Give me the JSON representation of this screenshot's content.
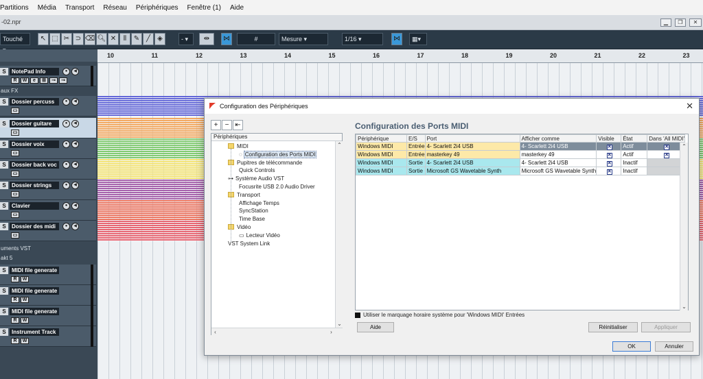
{
  "menubar": [
    "Partitions",
    "Média",
    "Transport",
    "Réseau",
    "Périphériques",
    "Fenêtre (1)",
    "Aide"
  ],
  "window": {
    "file_suffix": "-02.npr"
  },
  "toolbar": {
    "mode": "Touché",
    "quant_label": "Mesure",
    "quant_value": "1/16",
    "grid_symbol": "#"
  },
  "ruler": [
    "10",
    "11",
    "12",
    "13",
    "14",
    "15",
    "16",
    "17",
    "18",
    "19",
    "20",
    "21",
    "22",
    "23"
  ],
  "tracks": [
    {
      "name": "NotePad Info",
      "selected": false
    },
    {
      "name": "Dossier percuss",
      "selected": false,
      "color": "#5b5fd6"
    },
    {
      "name": "Dossier guitare",
      "selected": true,
      "color": "#f3a457"
    },
    {
      "name": "Dossier voix",
      "selected": false,
      "color": "#7cc96a"
    },
    {
      "name": "Dossier back voc",
      "selected": false,
      "color": "#f4e36a"
    },
    {
      "name": "Dossier strings",
      "selected": false,
      "color": "#a25aa8"
    },
    {
      "name": "Clavier",
      "selected": false,
      "color": "#ec6b55"
    },
    {
      "name": "Dossier des midi",
      "selected": false,
      "color": "#e85e6b"
    },
    {
      "name": "MIDI file generate"
    },
    {
      "name": "MIDI file generate"
    },
    {
      "name": "MIDI file generate"
    },
    {
      "name": "Instrument Track"
    }
  ],
  "folder_labels": {
    "fx": "aux FX",
    "vst": "uments VST",
    "kit": "akt 5"
  },
  "dialog": {
    "title": "Configuration des Périphériques",
    "close": "✕",
    "tree_header": "Périphériques",
    "tree": [
      {
        "label": "MIDI",
        "type": "folder",
        "indent": 0
      },
      {
        "label": "Configuration des Ports MIDI",
        "type": "leaf",
        "indent": 1,
        "selected": true
      },
      {
        "label": "Pupitres de télécommande",
        "type": "folder",
        "indent": 0
      },
      {
        "label": "Quick Controls",
        "type": "leaf",
        "indent": 1
      },
      {
        "label": "Système Audio VST",
        "type": "audio",
        "indent": 0
      },
      {
        "label": "Focusrite USB 2.0 Audio Driver",
        "type": "leaf",
        "indent": 1
      },
      {
        "label": "Transport",
        "type": "folder",
        "indent": 0
      },
      {
        "label": "Affichage Temps",
        "type": "leaf",
        "indent": 1
      },
      {
        "label": "SyncStation",
        "type": "leaf",
        "indent": 1
      },
      {
        "label": "Time Base",
        "type": "leaf",
        "indent": 1
      },
      {
        "label": "Vidéo",
        "type": "folder",
        "indent": 0
      },
      {
        "label": "Lecteur Vidéo",
        "type": "video",
        "indent": 1
      },
      {
        "label": "VST System Link",
        "type": "plain",
        "indent": 0
      }
    ],
    "ports_title": "Configuration des Ports MIDI",
    "columns": [
      "Périphérique",
      "E/S",
      "Port",
      "Afficher comme",
      "Visible",
      "État",
      "Dans 'All MIDI'"
    ],
    "rows": [
      {
        "device": "Windows MIDI",
        "io": "Entrée",
        "port": "4- Scarlett 2i4 USB",
        "display": "4- Scarlett 2i4 USB",
        "visible": true,
        "state": "Actif",
        "all_midi": true,
        "row_color": "#fde9a8",
        "sel": true
      },
      {
        "device": "Windows MIDI",
        "io": "Entrée",
        "port": "masterkey 49",
        "display": "masterkey 49",
        "visible": true,
        "state": "Actif",
        "all_midi": true,
        "row_color": "#fde9a8",
        "sel": false
      },
      {
        "device": "Windows MIDI",
        "io": "Sortie",
        "port": "4- Scarlett 2i4 USB",
        "display": "4- Scarlett 2i4 USB",
        "visible": true,
        "state": "Inactif",
        "all_midi": false,
        "row_color": "#a9e8ee",
        "sel": false
      },
      {
        "device": "Windows MIDI",
        "io": "Sortie",
        "port": "Microsoft GS Wavetable Synth",
        "display": "Microsoft GS Wavetable Synth",
        "visible": true,
        "state": "Inactif",
        "all_midi": false,
        "row_color": "#a9e8ee",
        "sel": false
      }
    ],
    "sys_option": "Utiliser le marquage horaire système pour 'Windows MIDI' Entrées",
    "buttons": {
      "help": "Aide",
      "reset": "Réinitialiser",
      "apply": "Appliquer",
      "ok": "OK",
      "cancel": "Annuler"
    },
    "tree_buttons": [
      "+",
      "−",
      "⇤"
    ]
  }
}
